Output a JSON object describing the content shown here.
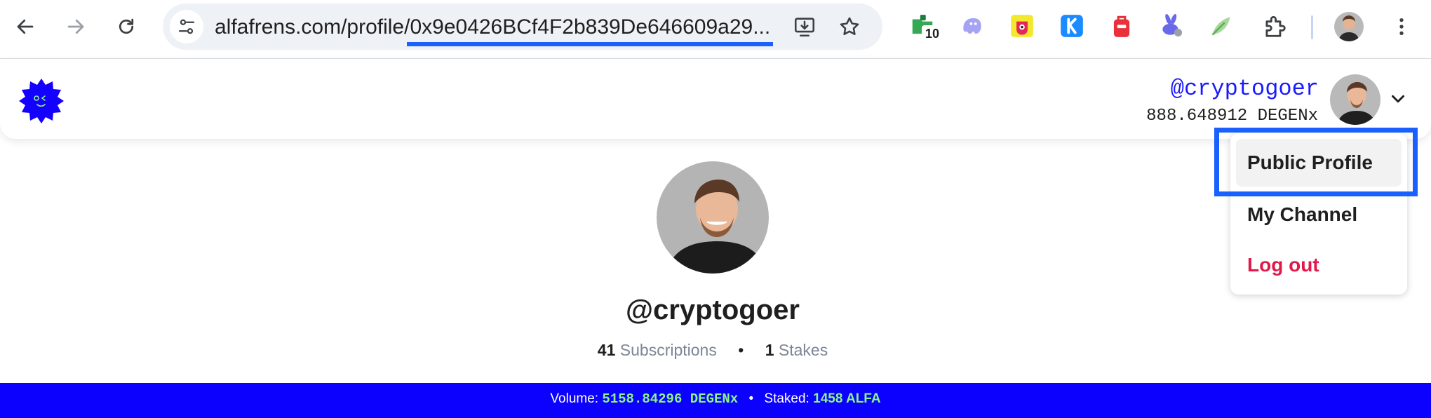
{
  "browser": {
    "url": "alfafrens.com/profile/0x9e0426BCf4F2b839De646609a29...",
    "extension_badge": "10",
    "colors": {
      "highlight": "#1a60ff",
      "omnibox_bg": "#eef1f6"
    },
    "icons": [
      "back-arrow-icon",
      "forward-arrow-icon",
      "reload-icon",
      "site-settings-icon",
      "install-app-icon",
      "bookmark-star-icon",
      "extensions-puzzle-icon",
      "menu-kebab-icon"
    ]
  },
  "header": {
    "username": "@cryptogoer",
    "balance": "888.648912 DEGENx",
    "colors": {
      "username": "#1a1aff",
      "logo": "#1400ff"
    }
  },
  "dropdown": {
    "items": [
      {
        "label": "Public Profile"
      },
      {
        "label": "My Channel"
      },
      {
        "label": "Log out"
      }
    ],
    "colors": {
      "logout": "#e0194a"
    }
  },
  "profile": {
    "username": "@cryptogoer",
    "subscriptions_count": "41",
    "subscriptions_label": "Subscriptions",
    "separator": "•",
    "stakes_count": "1",
    "stakes_label": "Stakes"
  },
  "footer": {
    "volume_label": "Volume:",
    "volume_value": "5158.84296 DEGENx",
    "separator": "•",
    "staked_label": "Staked:",
    "staked_value": "1458 ALFA",
    "colors": {
      "background": "#0c00ff",
      "value": "#8cf58a"
    }
  }
}
